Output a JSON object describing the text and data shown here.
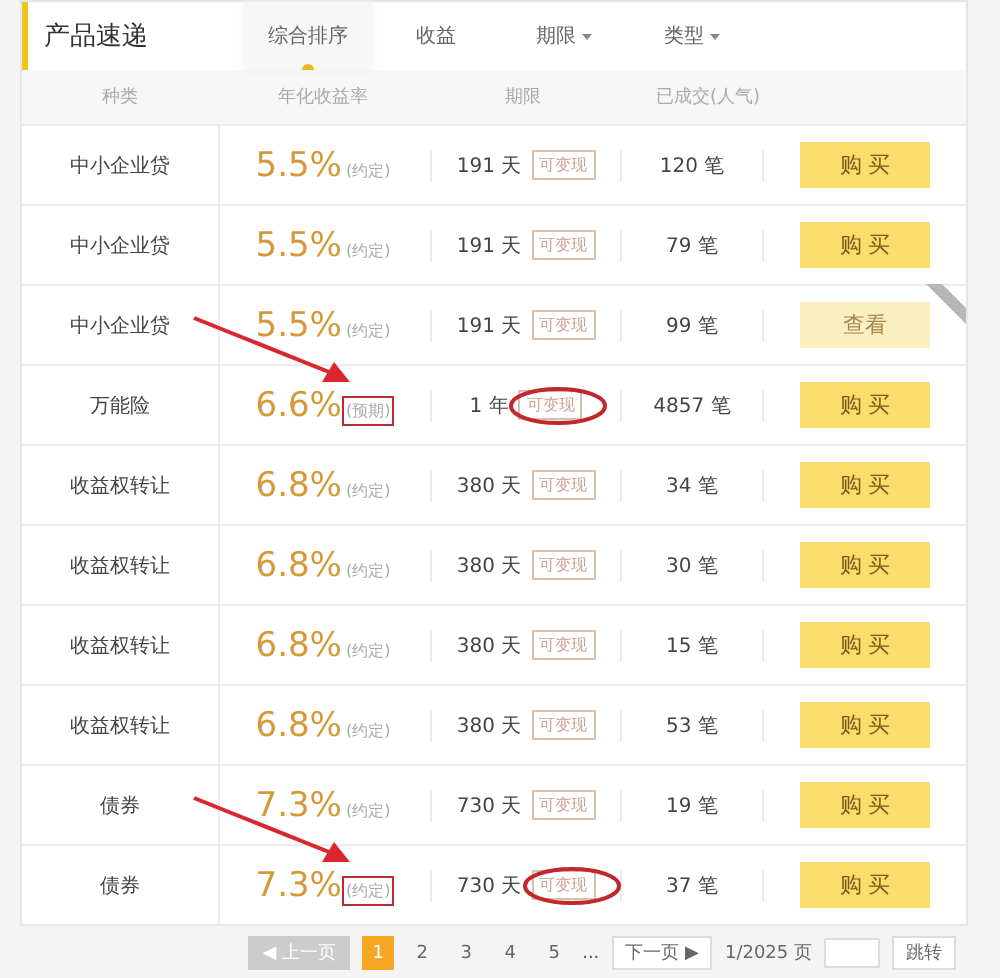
{
  "header": {
    "title": "产品速递",
    "tabs": [
      {
        "label": "综合排序",
        "selected": true,
        "dropdown": false
      },
      {
        "label": "收益",
        "selected": false,
        "dropdown": false
      },
      {
        "label": "期限",
        "selected": false,
        "dropdown": true
      },
      {
        "label": "类型",
        "selected": false,
        "dropdown": true
      }
    ]
  },
  "columns": [
    "种类",
    "年化收益率",
    "期限",
    "已成交(人气)"
  ],
  "rows": [
    {
      "type": "中小企业贷",
      "rate": "5.5%",
      "rate_note": "(约定)",
      "term": "191 天",
      "tag": "可变现",
      "count": "120 笔",
      "action": {
        "kind": "buy",
        "label": "购 买"
      },
      "ribbon": false,
      "marked": false
    },
    {
      "type": "中小企业贷",
      "rate": "5.5%",
      "rate_note": "(约定)",
      "term": "191 天",
      "tag": "可变现",
      "count": "79 笔",
      "action": {
        "kind": "buy",
        "label": "购 买"
      },
      "ribbon": false,
      "marked": false
    },
    {
      "type": "中小企业贷",
      "rate": "5.5%",
      "rate_note": "(约定)",
      "term": "191 天",
      "tag": "可变现",
      "count": "99 笔",
      "action": {
        "kind": "view",
        "label": "查看"
      },
      "ribbon": true,
      "marked": false
    },
    {
      "type": "万能险",
      "rate": "6.6%",
      "rate_note": "(预期)",
      "term": "1 年",
      "tag": "可变现",
      "count": "4857 笔",
      "action": {
        "kind": "buy",
        "label": "购 买"
      },
      "ribbon": false,
      "marked": true
    },
    {
      "type": "收益权转让",
      "rate": "6.8%",
      "rate_note": "(约定)",
      "term": "380 天",
      "tag": "可变现",
      "count": "34 笔",
      "action": {
        "kind": "buy",
        "label": "购 买"
      },
      "ribbon": false,
      "marked": false
    },
    {
      "type": "收益权转让",
      "rate": "6.8%",
      "rate_note": "(约定)",
      "term": "380 天",
      "tag": "可变现",
      "count": "30 笔",
      "action": {
        "kind": "buy",
        "label": "购 买"
      },
      "ribbon": false,
      "marked": false
    },
    {
      "type": "收益权转让",
      "rate": "6.8%",
      "rate_note": "(约定)",
      "term": "380 天",
      "tag": "可变现",
      "count": "15 笔",
      "action": {
        "kind": "buy",
        "label": "购 买"
      },
      "ribbon": false,
      "marked": false
    },
    {
      "type": "收益权转让",
      "rate": "6.8%",
      "rate_note": "(约定)",
      "term": "380 天",
      "tag": "可变现",
      "count": "53 笔",
      "action": {
        "kind": "buy",
        "label": "购 买"
      },
      "ribbon": false,
      "marked": false
    },
    {
      "type": "债券",
      "rate": "7.3%",
      "rate_note": "(约定)",
      "term": "730 天",
      "tag": "可变现",
      "count": "19 笔",
      "action": {
        "kind": "buy",
        "label": "购 买"
      },
      "ribbon": false,
      "marked": false
    },
    {
      "type": "债券",
      "rate": "7.3%",
      "rate_note": "(约定)",
      "term": "730 天",
      "tag": "可变现",
      "count": "37 笔",
      "action": {
        "kind": "buy",
        "label": "购 买"
      },
      "ribbon": false,
      "marked": true
    }
  ],
  "pagination": {
    "prev": {
      "label": "◀ 上一页",
      "disabled": true
    },
    "pages": [
      {
        "label": "1",
        "selected": true
      },
      {
        "label": "2",
        "selected": false
      },
      {
        "label": "3",
        "selected": false
      },
      {
        "label": "4",
        "selected": false
      },
      {
        "label": "5",
        "selected": false
      }
    ],
    "ellipsis": "...",
    "next": "下一页 ▶",
    "page_info": "1/2025 页",
    "jump": "跳转"
  }
}
